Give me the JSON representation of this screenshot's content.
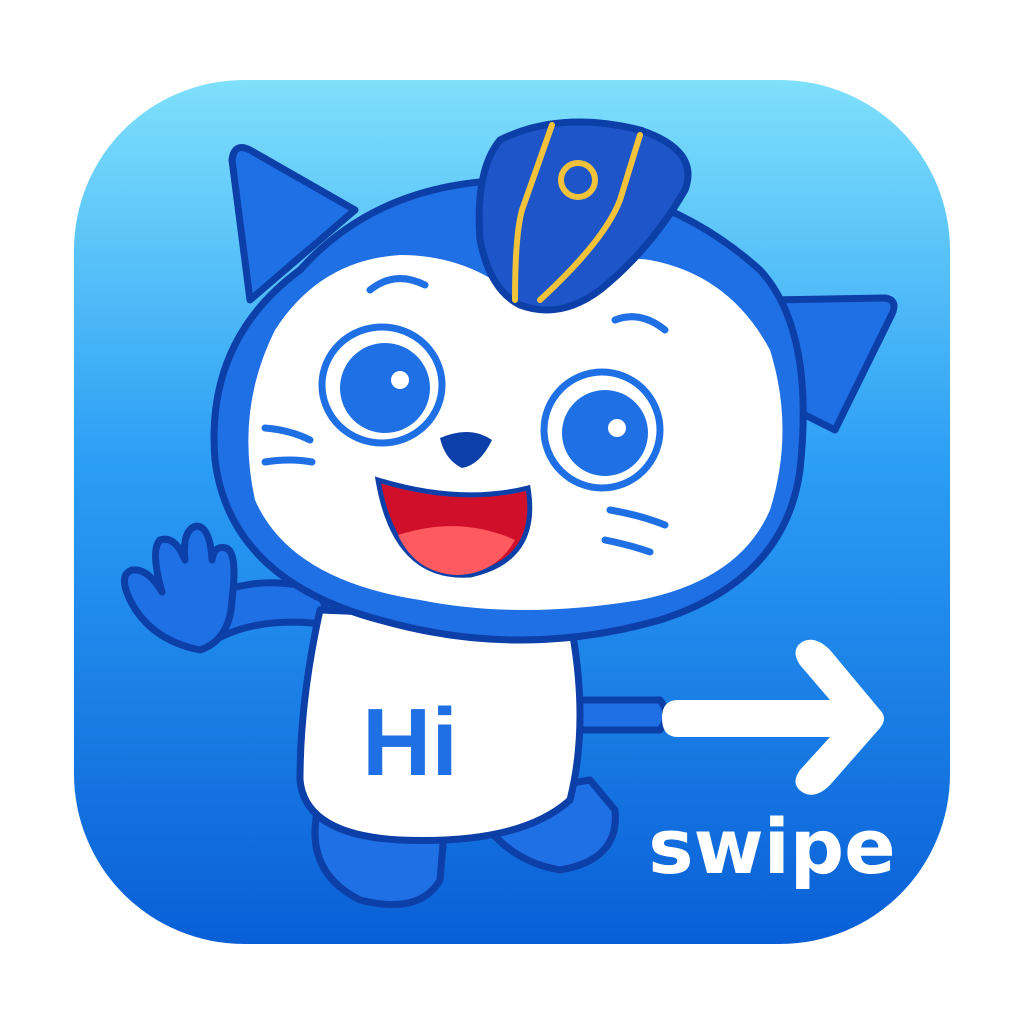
{
  "icon": {
    "shirt_text": "Hi",
    "caption": "swipe",
    "arrow_icon": "arrow-right-icon",
    "mascot_icon": "cat-mascot-icon",
    "colors": {
      "background_top": "#7fe0fb",
      "background_mid": "#2a9df5",
      "background_bottom": "#0a5fd6",
      "mascot_blue": "#1f6fe5",
      "mascot_outline": "#0d3fa8",
      "face_white": "#ffffff",
      "hat_blue": "#1e55c8",
      "hat_stripe": "#f2c33a",
      "mouth_red": "#d0102a",
      "tongue_pink": "#ff5a5f",
      "caption_white": "#ffffff"
    }
  }
}
